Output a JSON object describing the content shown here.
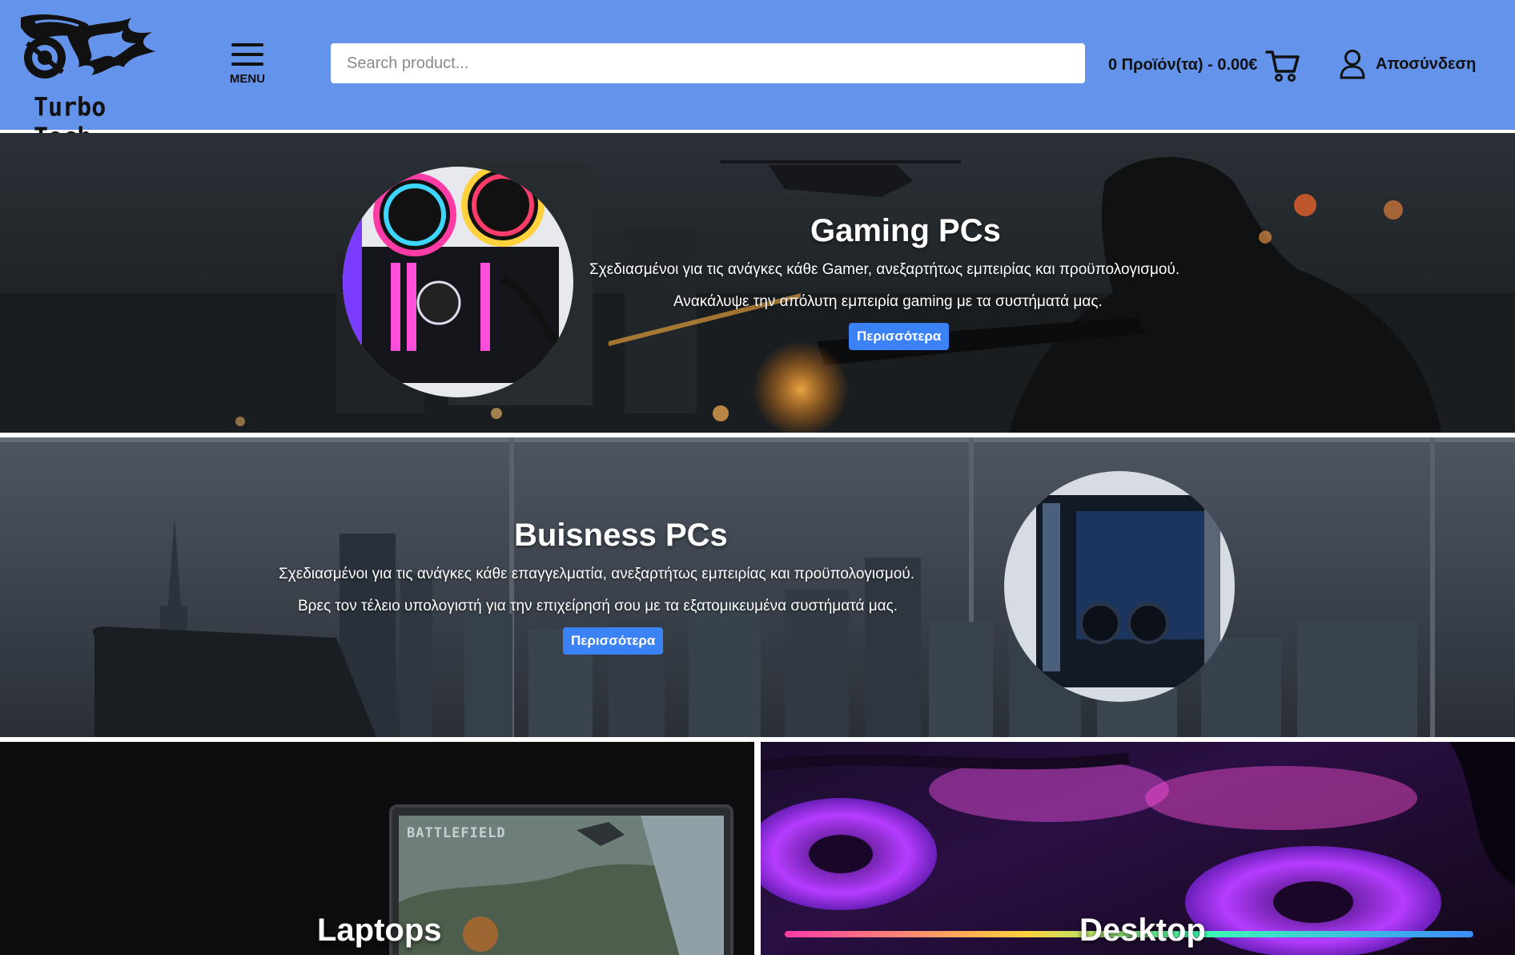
{
  "header": {
    "logo_text": "Turbo Tech",
    "menu_label": "MENU",
    "search_placeholder": "Search product...",
    "cart_summary": "0 Προϊόν(τα) - 0.00€",
    "user_label": "Αποσύνδεση"
  },
  "banners": [
    {
      "title": "Gaming PCs",
      "line1": "Σχεδιασμένοι για τις ανάγκες κάθε Gamer, ανεξαρτήτως εμπειρίας και προϋπολογισμού.",
      "line2": "Ανακάλυψε την απόλυτη εμπειρία gaming με τα συστήματά μας.",
      "button": "Περισσότερα"
    },
    {
      "title": "Buisness PCs",
      "line1": "Σχεδιασμένοι για τις ανάγκες κάθε επαγγελματία, ανεξαρτήτως εμπειρίας και προϋπολογισμού.",
      "line2": "Βρες τον τέλειο υπολογιστή για την επιχείρησή σου με τα εξατομικευμένα συστήματά μας.",
      "button": "Περισσότερα"
    }
  ],
  "tiles": [
    {
      "title": "Laptops",
      "screen_text": "BATTLEFIELD"
    },
    {
      "title": "Desktop"
    }
  ],
  "colors": {
    "header_bg": "#6393eb",
    "button_bg": "#3b82f6",
    "text_dark": "#111111"
  }
}
